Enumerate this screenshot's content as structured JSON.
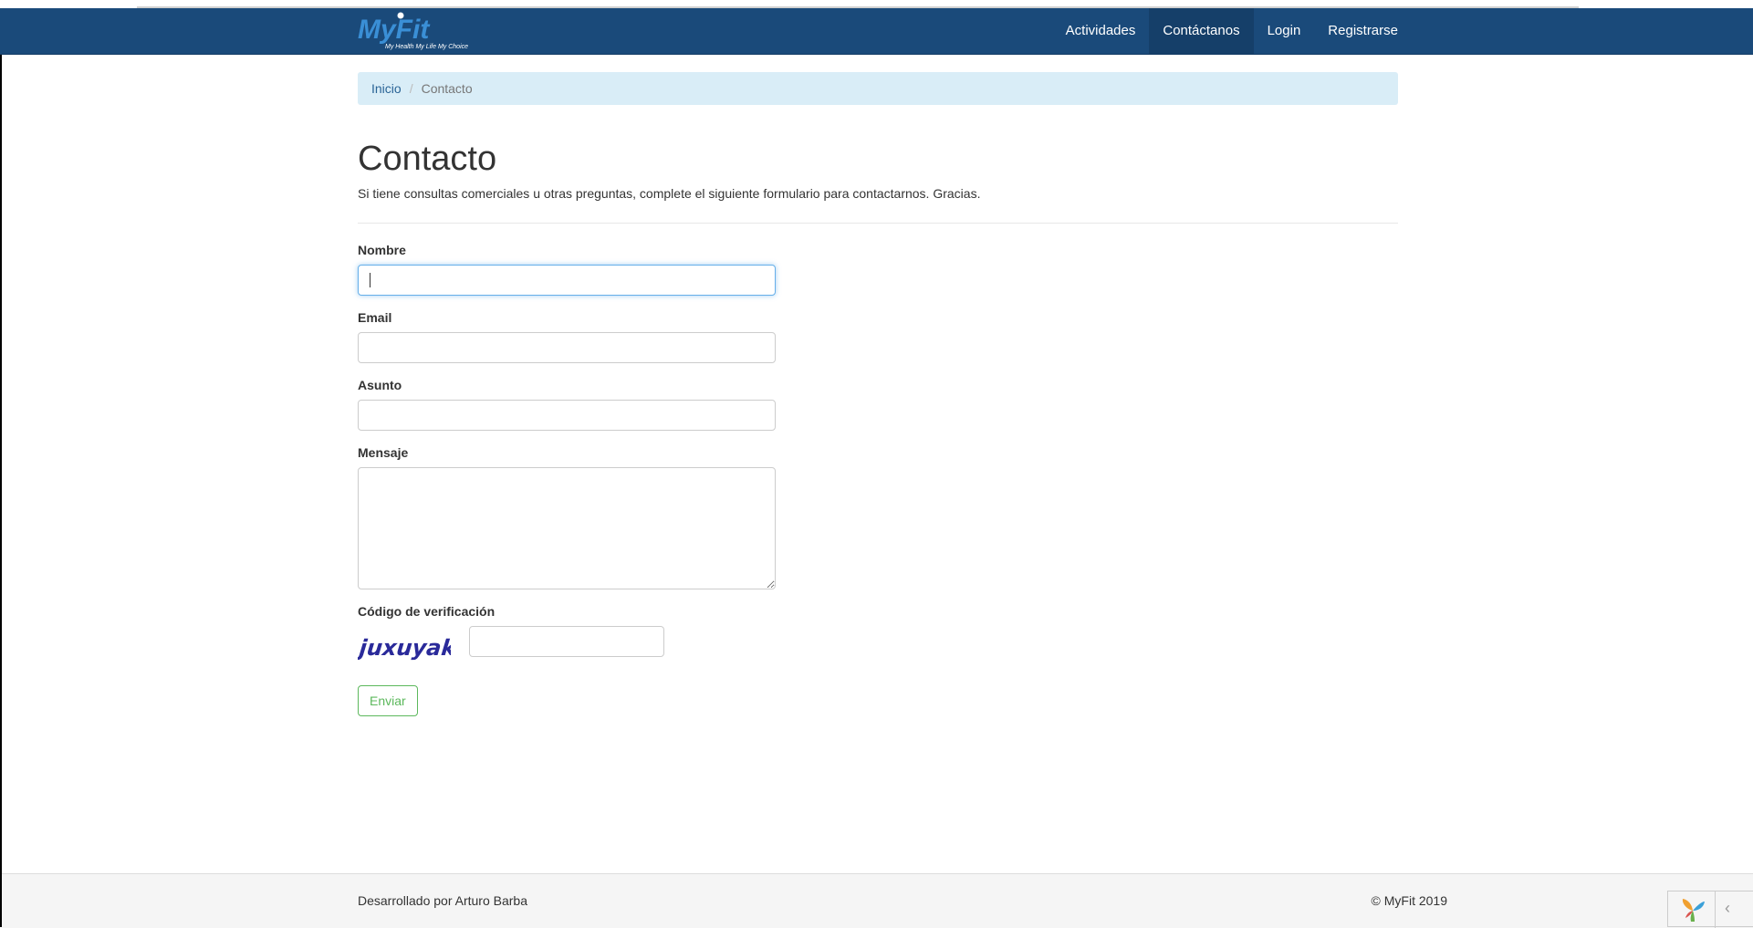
{
  "brand": {
    "name": "MyFit",
    "tagline": "My Health My Life My Choice"
  },
  "nav": {
    "items": [
      {
        "label": "Actividades",
        "active": false
      },
      {
        "label": "Contáctanos",
        "active": true
      },
      {
        "label": "Login",
        "active": false
      },
      {
        "label": "Registrarse",
        "active": false
      }
    ]
  },
  "breadcrumb": {
    "home": "Inicio",
    "separator": "/",
    "current": "Contacto"
  },
  "page": {
    "title": "Contacto",
    "intro": "Si tiene consultas comerciales u otras preguntas, complete el siguiente formulario para contactarnos. Gracias."
  },
  "form": {
    "name_label": "Nombre",
    "name_value": "",
    "email_label": "Email",
    "email_value": "",
    "subject_label": "Asunto",
    "subject_value": "",
    "message_label": "Mensaje",
    "message_value": "",
    "captcha_label": "Código de verificación",
    "captcha_text": "juxuyak",
    "captcha_value": "",
    "submit_label": "Enviar"
  },
  "footer": {
    "left": "Desarrollado por Arturo Barba",
    "right": "© MyFit 2019"
  },
  "debug": {
    "toggle_glyph": "‹"
  },
  "colors": {
    "navbar": "#1a4a7a",
    "breadcrumb_bg": "#d9edf7",
    "submit": "#5cb85c",
    "captcha": "#2a2a9a"
  }
}
